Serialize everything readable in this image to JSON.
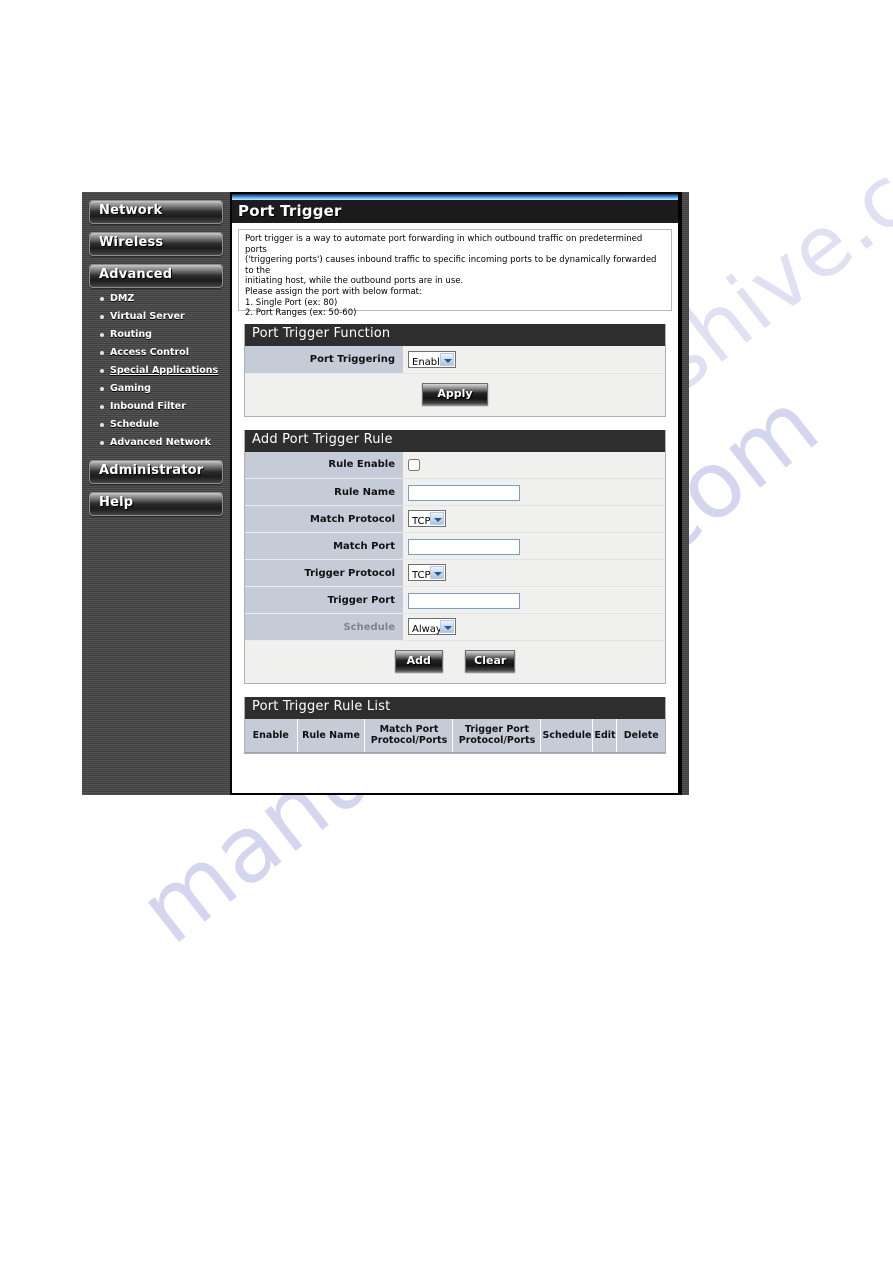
{
  "sidebar": {
    "buttons": [
      {
        "label": "Network"
      },
      {
        "label": "Wireless"
      },
      {
        "label": "Advanced"
      },
      {
        "label": "Administrator"
      },
      {
        "label": "Help"
      }
    ],
    "advanced_submenu": [
      {
        "label": "DMZ",
        "active": false
      },
      {
        "label": "Virtual Server",
        "active": false
      },
      {
        "label": "Routing",
        "active": false
      },
      {
        "label": "Access Control",
        "active": false
      },
      {
        "label": "Special Applications",
        "active": true
      },
      {
        "label": "Gaming",
        "active": false
      },
      {
        "label": "Inbound Filter",
        "active": false
      },
      {
        "label": "Schedule",
        "active": false
      },
      {
        "label": "Advanced Network",
        "active": false
      }
    ]
  },
  "page": {
    "title": "Port Trigger",
    "description": {
      "line1": "Port trigger is a way to automate port forwarding in which outbound traffic on predetermined ports",
      "line2": "('triggering ports') causes inbound traffic to specific incoming ports to be dynamically forwarded to the",
      "line3": "initiating host, while the outbound ports are in use.",
      "line4": "Please assign the port with below format:",
      "line5": "1. Single Port (ex: 80)",
      "line6": "2. Port Ranges (ex: 50-60)"
    }
  },
  "function_panel": {
    "header": "Port Trigger Function",
    "port_triggering_label": "Port Triggering",
    "port_triggering_value": "Enable",
    "apply_label": "Apply"
  },
  "add_rule_panel": {
    "header": "Add Port Trigger Rule",
    "rule_enable_label": "Rule Enable",
    "rule_enable_checked": false,
    "rule_name_label": "Rule Name",
    "rule_name_value": "",
    "match_protocol_label": "Match Protocol",
    "match_protocol_value": "TCP",
    "match_port_label": "Match Port",
    "match_port_value": "",
    "trigger_protocol_label": "Trigger Protocol",
    "trigger_protocol_value": "TCP",
    "trigger_port_label": "Trigger Port",
    "trigger_port_value": "",
    "schedule_label": "Schedule",
    "schedule_value": "Always",
    "add_label": "Add",
    "clear_label": "Clear"
  },
  "rule_list_panel": {
    "header": "Port Trigger Rule List",
    "columns": [
      {
        "line1": "Enable",
        "line2": ""
      },
      {
        "line1": "Rule Name",
        "line2": ""
      },
      {
        "line1": "Match Port",
        "line2": "Protocol/Ports"
      },
      {
        "line1": "Trigger Port",
        "line2": "Protocol/Ports"
      },
      {
        "line1": "Schedule",
        "line2": ""
      },
      {
        "line1": "Edit",
        "line2": ""
      },
      {
        "line1": "Delete",
        "line2": ""
      }
    ],
    "rows": []
  },
  "watermark": {
    "text_a": "manualshive.com",
    "text_b": "manualshive.com"
  },
  "colors": {
    "panel_header": "#2e2e2e",
    "label_cell": "#c5ccd8",
    "field_cell": "#f0f0ee",
    "title_bar": "#1c1c1c",
    "accent_blue": "#3f8fd6",
    "watermark": "#b9bde4"
  }
}
